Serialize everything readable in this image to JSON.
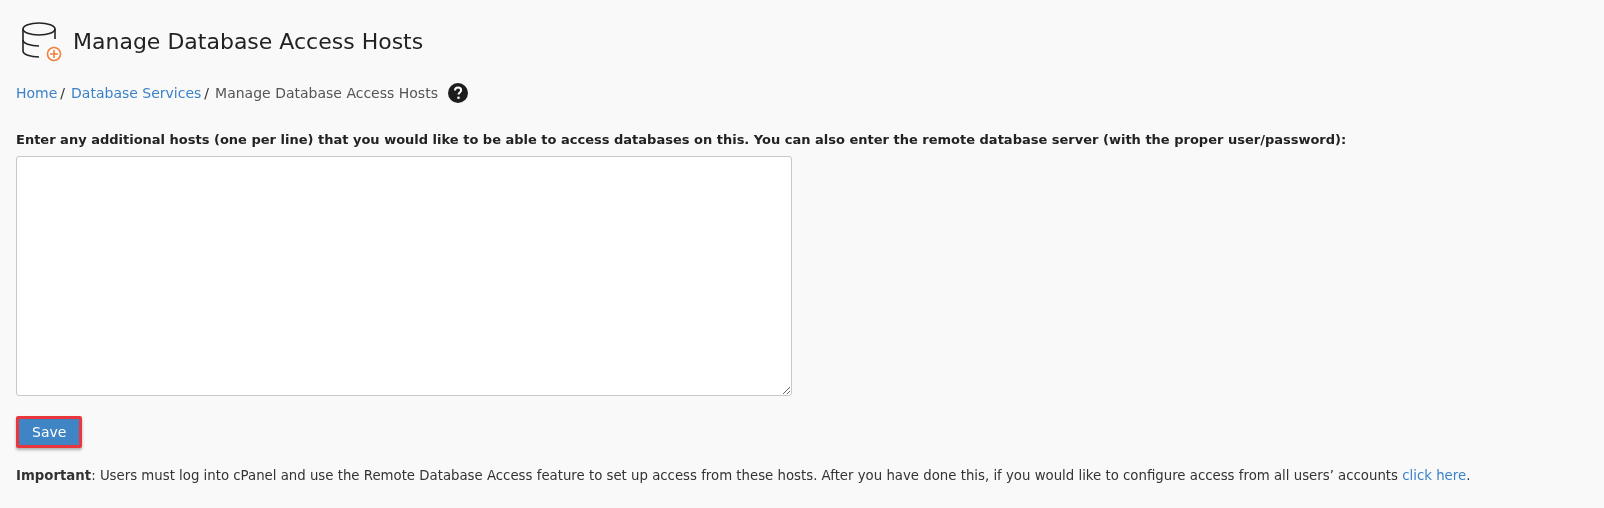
{
  "page": {
    "title": "Manage Database Access Hosts"
  },
  "breadcrumb": [
    {
      "label": "Home",
      "kind": "link",
      "separator": "/"
    },
    {
      "label": "Database Services",
      "kind": "link",
      "separator": "/"
    },
    {
      "label": "Manage Database Access Hosts",
      "kind": "current"
    }
  ],
  "form": {
    "label": "Enter any additional hosts (one per line) that you would like to be able to access databases on this. You can also enter the remote database server (with the proper user/password):",
    "save_button": {
      "label": "Save",
      "highlighted": true
    }
  },
  "note": {
    "text": "**Important**: Users must log into cPanel and use the Remote Database Access feature to set up access from these hosts. After you have done this, if you would like to configure access from all users’ accounts",
    "link": "click here",
    "end": "."
  }
}
